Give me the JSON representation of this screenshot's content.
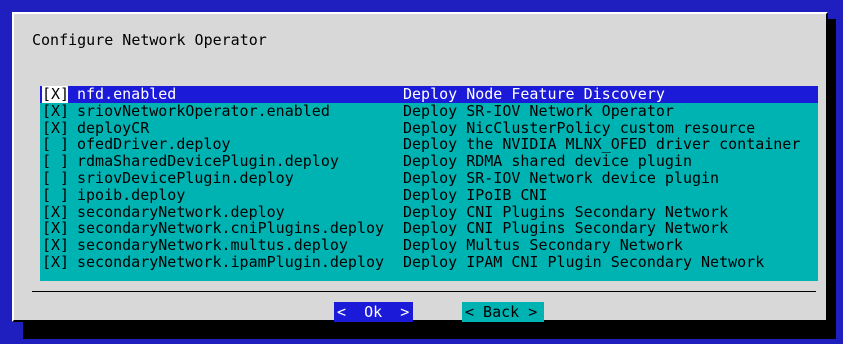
{
  "dialog": {
    "title": "Configure Network Operator"
  },
  "items": [
    {
      "checkbox": "[X]",
      "name": "nfd.enabled",
      "description": "Deploy Node Feature Discovery"
    },
    {
      "checkbox": "[X]",
      "name": "sriovNetworkOperator.enabled",
      "description": "Deploy SR-IOV Network Operator"
    },
    {
      "checkbox": "[X]",
      "name": "deployCR",
      "description": "Deploy NicClusterPolicy custom resource"
    },
    {
      "checkbox": "[ ]",
      "name": "ofedDriver.deploy",
      "description": "Deploy the NVIDIA MLNX_OFED driver container"
    },
    {
      "checkbox": "[ ]",
      "name": "rdmaSharedDevicePlugin.deploy",
      "description": "Deploy RDMA shared device plugin"
    },
    {
      "checkbox": "[ ]",
      "name": "sriovDevicePlugin.deploy",
      "description": "Deploy SR-IOV Network device plugin"
    },
    {
      "checkbox": "[ ]",
      "name": "ipoib.deploy",
      "description": "Deploy IPoIB CNI"
    },
    {
      "checkbox": "[X]",
      "name": "secondaryNetwork.deploy",
      "description": "Deploy CNI Plugins Secondary Network"
    },
    {
      "checkbox": "[X]",
      "name": "secondaryNetwork.cniPlugins.deploy",
      "description": "Deploy CNI Plugins Secondary Network"
    },
    {
      "checkbox": "[X]",
      "name": "secondaryNetwork.multus.deploy",
      "description": "Deploy Multus Secondary Network"
    },
    {
      "checkbox": "[X]",
      "name": "secondaryNetwork.ipamPlugin.deploy",
      "description": "Deploy IPAM CNI Plugin Secondary Network"
    }
  ],
  "buttons": {
    "ok": "<  Ok  >",
    "back": "< Back >"
  },
  "colors": {
    "background": "#1f1fbf",
    "dialog": "#d8d8d8",
    "list": "#00b3b3",
    "selected": "#1a1ad8"
  }
}
